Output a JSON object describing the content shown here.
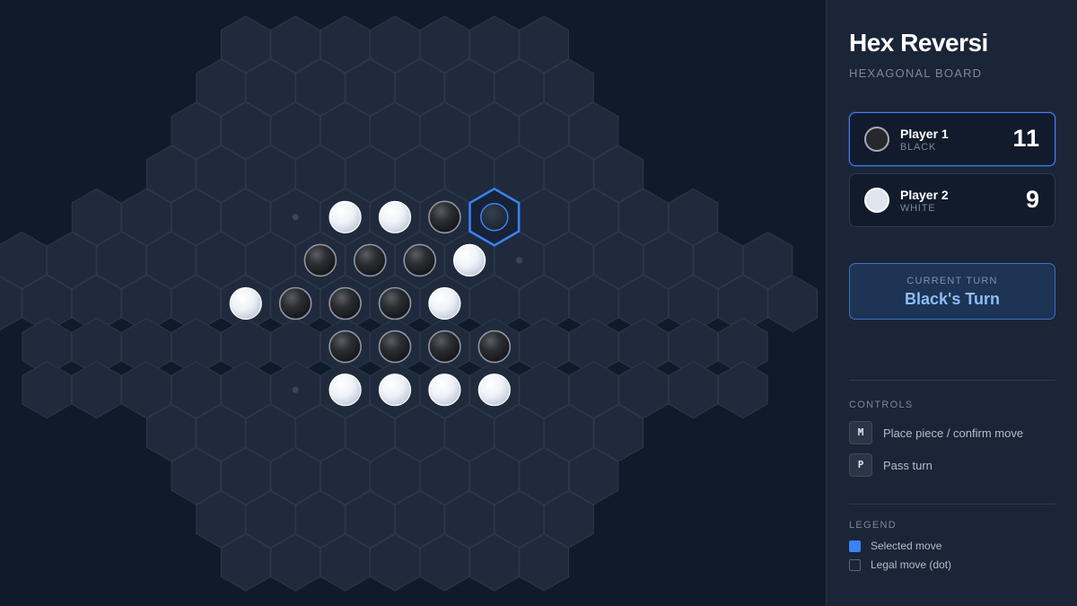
{
  "game": {
    "title": "Hex Reversi",
    "subtitle": "HEXAGONAL BOARD",
    "current_turn_label": "CURRENT TURN",
    "current_turn_value": "Black's Turn"
  },
  "players": [
    {
      "name": "Player 1",
      "color": "BLACK",
      "score": "11",
      "active": true
    },
    {
      "name": "Player 2",
      "color": "WHITE",
      "score": "9",
      "active": false
    }
  ],
  "controls": {
    "heading": "CONTROLS",
    "items": [
      {
        "key": "M",
        "label": "Place piece / confirm move"
      },
      {
        "key": "P",
        "label": "Pass turn"
      }
    ]
  },
  "legend": {
    "heading": "LEGEND",
    "items": [
      {
        "label": "Selected move"
      },
      {
        "label": "Legal move (dot)"
      }
    ]
  },
  "board": {
    "radius": 6,
    "rows": [
      "...............",
      "...............",
      "...............",
      "...............",
      "...............",
      "..........",
      "...............",
      ".....",
      "..............."
    ],
    "row_strings": [
      ".......",
      "........",
      ".........",
      "..........",
      "....oWWBS....",
      "......BBBWo.....",
      ".....WBBBW.......",
      "......BBBB.....",
      ".....oWWWW.....",
      "..........",
      ".........",
      "........",
      "......."
    ],
    "colors": {
      "cell_fill": "#1f2a3c",
      "cell_stroke": "#2d384b",
      "selected": "#3b82f6",
      "black_piece": "#2a2c30",
      "white_piece": "#e8edf5"
    }
  }
}
